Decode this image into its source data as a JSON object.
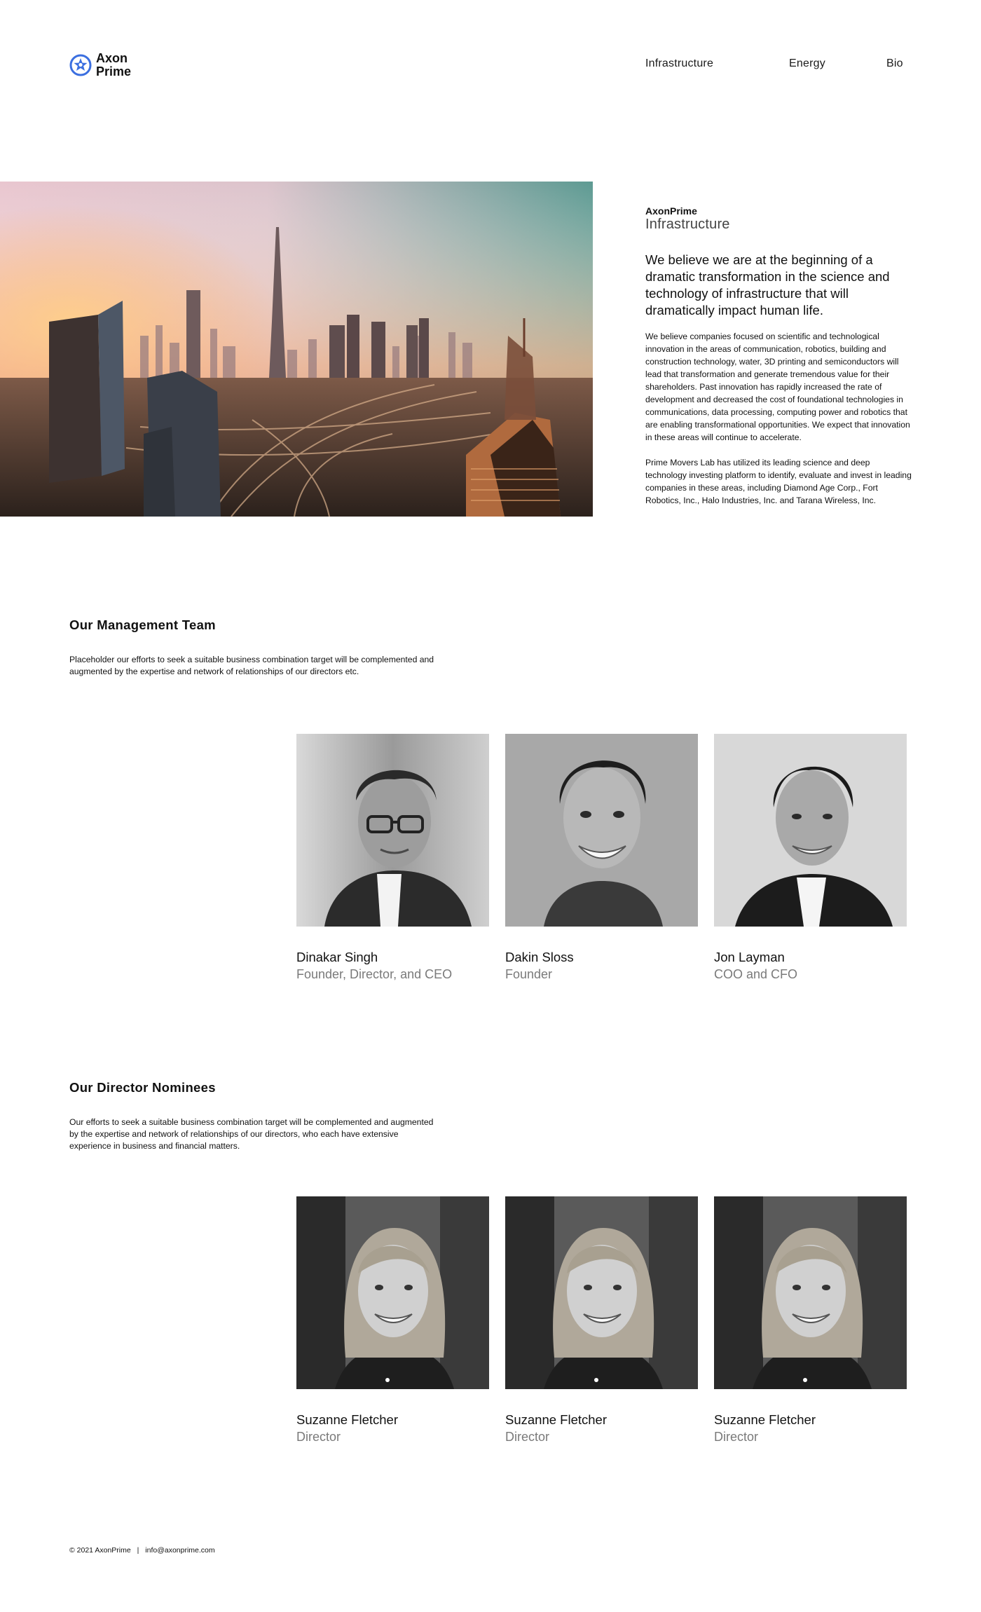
{
  "brand": {
    "name_line1": "Axon",
    "name_line2": "Prime",
    "accent_color": "#3b6fe0",
    "logo_icon": "star-ring-icon"
  },
  "nav": {
    "items": [
      {
        "label": "Infrastructure"
      },
      {
        "label": "Energy"
      },
      {
        "label": "Bio"
      }
    ]
  },
  "hero": {
    "image": "city-skyline-image",
    "brand": "AxonPrime",
    "subtitle": "Infrastructure",
    "lead": "We believe we are at the beginning of a dramatic transformation in the science and technology of infrastructure that will dramatically impact human life.",
    "paragraphs": [
      "We believe companies focused on scientific and technological innovation in the areas of communication, robotics, building and construction technology, water, 3D printing and semiconductors will lead that transformation and generate tremendous value for their shareholders. Past innovation has rapidly increased the rate of development and decreased the cost of foundational technologies in communications, data processing, computing power and robotics that are enabling transformational opportunities. We expect that innovation in these areas will continue to accelerate.",
      "Prime Movers Lab has utilized its leading science and deep technology investing platform to identify, evaluate and invest in leading companies in these areas, including Diamond Age Corp., Fort Robotics, Inc., Halo Industries, Inc. and Tarana Wireless, Inc."
    ]
  },
  "management": {
    "title": "Our Management Team",
    "description": "Placeholder our efforts to seek a suitable business combination target will be complemented and augmented by the expertise and network of relationships of our directors etc.",
    "people": [
      {
        "name": "Dinakar Singh",
        "role": "Founder, Director, and CEO"
      },
      {
        "name": "Dakin Sloss",
        "role": "Founder"
      },
      {
        "name": "Jon Layman",
        "role": "COO and CFO"
      }
    ]
  },
  "directors": {
    "title": "Our Director Nominees",
    "description": "Our efforts to seek a suitable business combination target will be complemented and augmented by the expertise and network of relationships of our directors, who each have extensive experience in business and financial matters.",
    "people": [
      {
        "name": "Suzanne Fletcher",
        "role": "Director"
      },
      {
        "name": "Suzanne Fletcher",
        "role": "Director"
      },
      {
        "name": "Suzanne Fletcher",
        "role": "Director"
      }
    ]
  },
  "footer": {
    "copyright": "© 2021 AxonPrime",
    "separator": "|",
    "email": "info@axonprime.com"
  }
}
